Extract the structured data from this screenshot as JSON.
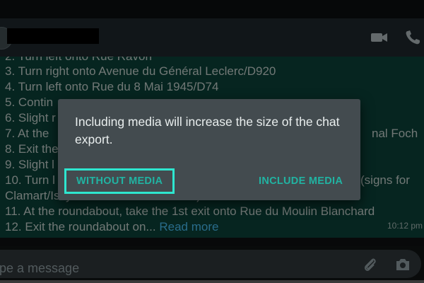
{
  "header": {
    "icons": {
      "video": "video-call-icon",
      "phone": "phone-call-icon"
    }
  },
  "chat": {
    "lines": [
      "2. Turn left onto Rue Ravon",
      "3. Turn right onto Avenue du Général Leclerc/D920",
      "4. Turn left onto Rue du 8 Mai 1945/D74",
      "5. Contin",
      "6. Slight r",
      "7. At the",
      "8. Exit the",
      "9. Slight l",
      "10. Turn l",
      "Clamart/Issy-les-Moulineaux-Centre)",
      "11. At the roundabout, take the 1st exit onto Rue du Moulin Blanchard",
      "12. Exit the roundabout on..."
    ],
    "line7_tail": "nal Foch",
    "line10_tail": "(signs for",
    "read_more": "Read more",
    "time": "10:12 pm"
  },
  "dialog": {
    "message": "Including media will increase the size of the chat export.",
    "without_media": "WITHOUT MEDIA",
    "include_media": "INCLUDE MEDIA"
  },
  "input": {
    "placeholder": "Type a message",
    "icons": {
      "attach": "paperclip-icon",
      "camera": "camera-icon"
    }
  },
  "colors": {
    "accent": "#21b3a2",
    "focus_outline": "#2ee6cf",
    "bubble": "#0a3a32",
    "dialog_bg": "#434b4f",
    "link": "#3fa7d6"
  }
}
